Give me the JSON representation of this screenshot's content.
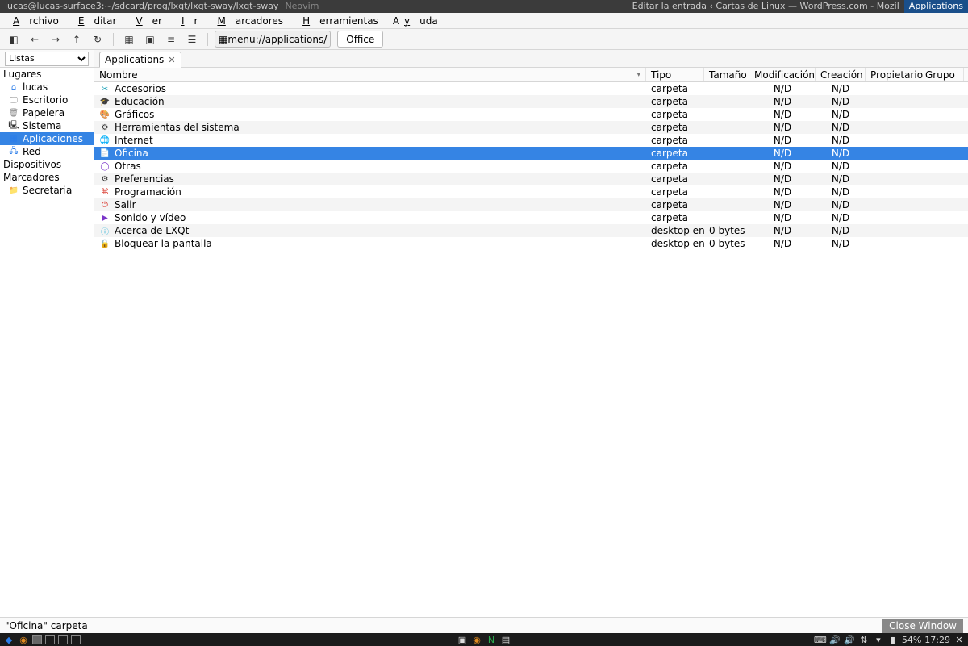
{
  "wm": {
    "left_title": "lucas@lucas-surface3:~/sdcard/prog/lxqt/lxqt-sway/lxqt-sway",
    "left_app": "Neovim",
    "mid_title": "Editar la entrada ‹ Cartas de Linux — WordPress.com - Mozil",
    "active": "Applications"
  },
  "menu": [
    "Archivo",
    "Editar",
    "Ver",
    "Ir",
    "Marcadores",
    "Herramientas",
    "Ayuda"
  ],
  "toolbar": {
    "path": "menu://applications/",
    "crumb": "Office"
  },
  "sidebar_dropdown": "Listas",
  "sidebar": {
    "lugares_header": "Lugares",
    "lugares": [
      {
        "label": "lucas",
        "icon": "folder-home-icon",
        "cls": "ic-blue"
      },
      {
        "label": "Escritorio",
        "icon": "desktop-icon",
        "cls": "ic-grey"
      },
      {
        "label": "Papelera",
        "icon": "trash-icon",
        "cls": "ic-grey"
      },
      {
        "label": "Sistema",
        "icon": "computer-icon",
        "cls": "ic-dark"
      },
      {
        "label": "Aplicaciones",
        "icon": "applications-icon",
        "cls": "ic-blue",
        "selected": true
      },
      {
        "label": "Red",
        "icon": "network-icon",
        "cls": "ic-blue"
      }
    ],
    "dispositivos_header": "Dispositivos",
    "dispositivos": [],
    "marcadores_header": "Marcadores",
    "marcadores": [
      {
        "label": "Secretaria",
        "icon": "folder-icon",
        "cls": "ic-blue"
      }
    ]
  },
  "tab": {
    "label": "Applications"
  },
  "columns": [
    "Nombre",
    "Tipo",
    "Tamaño",
    "Modificación",
    "Creación",
    "Propietario",
    "Grupo"
  ],
  "rows": [
    {
      "name": "Accesorios",
      "tipo": "carpeta",
      "tam": "",
      "mod": "N/D",
      "cre": "N/D",
      "prop": "",
      "grp": "",
      "icon": "accessories-icon",
      "cls": "ic-teal"
    },
    {
      "name": "Educación",
      "tipo": "carpeta",
      "tam": "",
      "mod": "N/D",
      "cre": "N/D",
      "prop": "",
      "grp": "",
      "icon": "education-icon",
      "cls": "ic-green"
    },
    {
      "name": "Gráficos",
      "tipo": "carpeta",
      "tam": "",
      "mod": "N/D",
      "cre": "N/D",
      "prop": "",
      "grp": "",
      "icon": "graphics-icon",
      "cls": "ic-pink"
    },
    {
      "name": "Herramientas del sistema",
      "tipo": "carpeta",
      "tam": "",
      "mod": "N/D",
      "cre": "N/D",
      "prop": "",
      "grp": "",
      "icon": "system-tools-icon",
      "cls": "ic-dark"
    },
    {
      "name": "Internet",
      "tipo": "carpeta",
      "tam": "",
      "mod": "N/D",
      "cre": "N/D",
      "prop": "",
      "grp": "",
      "icon": "internet-icon",
      "cls": "ic-blue"
    },
    {
      "name": "Oficina",
      "tipo": "carpeta",
      "tam": "",
      "mod": "N/D",
      "cre": "N/D",
      "prop": "",
      "grp": "",
      "icon": "office-icon",
      "cls": "ic-orange",
      "selected": true
    },
    {
      "name": "Otras",
      "tipo": "carpeta",
      "tam": "",
      "mod": "N/D",
      "cre": "N/D",
      "prop": "",
      "grp": "",
      "icon": "other-icon",
      "cls": "ic-purple"
    },
    {
      "name": "Preferencias",
      "tipo": "carpeta",
      "tam": "",
      "mod": "N/D",
      "cre": "N/D",
      "prop": "",
      "grp": "",
      "icon": "preferences-icon",
      "cls": "ic-dark"
    },
    {
      "name": "Programación",
      "tipo": "carpeta",
      "tam": "",
      "mod": "N/D",
      "cre": "N/D",
      "prop": "",
      "grp": "",
      "icon": "development-icon",
      "cls": "ic-red"
    },
    {
      "name": "Salir",
      "tipo": "carpeta",
      "tam": "",
      "mod": "N/D",
      "cre": "N/D",
      "prop": "",
      "grp": "",
      "icon": "logout-icon",
      "cls": "ic-red"
    },
    {
      "name": "Sonido y vídeo",
      "tipo": "carpeta",
      "tam": "",
      "mod": "N/D",
      "cre": "N/D",
      "prop": "",
      "grp": "",
      "icon": "multimedia-icon",
      "cls": "ic-purple"
    },
    {
      "name": "Acerca de LXQt",
      "tipo": "desktop entry",
      "tam": "0 bytes",
      "mod": "N/D",
      "cre": "N/D",
      "prop": "",
      "grp": "",
      "icon": "about-icon",
      "cls": "ic-cyan"
    },
    {
      "name": "Bloquear la pantalla",
      "tipo": "desktop entry",
      "tam": "0 bytes",
      "mod": "N/D",
      "cre": "N/D",
      "prop": "",
      "grp": "",
      "icon": "lock-icon",
      "cls": "ic-orange"
    }
  ],
  "status": {
    "text": "\"Oficina\" carpeta",
    "close": "Close Window"
  },
  "taskbar": {
    "battery": "54%",
    "clock": "17:29"
  }
}
